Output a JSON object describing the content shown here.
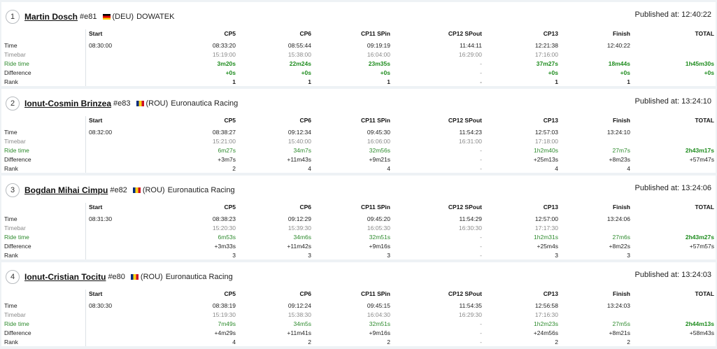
{
  "row_labels": {
    "time": "Time",
    "timebar": "Timebar",
    "ride_time": "Ride time",
    "difference": "Difference",
    "rank": "Rank"
  },
  "columns": [
    "Start",
    "CP5",
    "CP6",
    "CP11 SPin",
    "CP12 SPout",
    "CP13",
    "Finish",
    "TOTAL"
  ],
  "colors": {
    "ride_time": "#2e8b2e",
    "timebar": "#8a8a8a",
    "label_ride_time": "#2e8b2e"
  },
  "riders": [
    {
      "position": "1",
      "name": "Martin Dosch",
      "bib": "#e81",
      "flag": "flag-deu",
      "country": "(DEU)",
      "team": "DOWATEK",
      "published": "Published at: 12:40:22",
      "time": [
        "08:30:00",
        "08:33:20",
        "08:55:44",
        "09:19:19",
        "11:44:11",
        "12:21:38",
        "12:40:22",
        ""
      ],
      "timebar": [
        "",
        "15:19:00",
        "15:38:00",
        "16:04:00",
        "16:29:00",
        "17:16:00",
        "",
        ""
      ],
      "ride_time": [
        "",
        "3m20s",
        "22m24s",
        "23m35s",
        "-",
        "37m27s",
        "18m44s",
        "1h45m30s"
      ],
      "difference": [
        "",
        "+0s",
        "+0s",
        "+0s",
        "-",
        "+0s",
        "+0s",
        "+0s"
      ],
      "rank": [
        "",
        "1",
        "1",
        "1",
        "-",
        "1",
        "1",
        ""
      ]
    },
    {
      "position": "2",
      "name": "Ionut-Cosmin Brinzea",
      "bib": "#e83",
      "flag": "flag-rou",
      "country": "(ROU)",
      "team": "Euronautica Racing",
      "published": "Published at: 13:24:10",
      "time": [
        "08:32:00",
        "08:38:27",
        "09:12:34",
        "09:45:30",
        "11:54:23",
        "12:57:03",
        "13:24:10",
        ""
      ],
      "timebar": [
        "",
        "15:21:00",
        "15:40:00",
        "16:06:00",
        "16:31:00",
        "17:18:00",
        "",
        ""
      ],
      "ride_time": [
        "",
        "6m27s",
        "34m7s",
        "32m56s",
        "-",
        "1h2m40s",
        "27m7s",
        "2h43m17s"
      ],
      "difference": [
        "",
        "+3m7s",
        "+11m43s",
        "+9m21s",
        "-",
        "+25m13s",
        "+8m23s",
        "+57m47s"
      ],
      "rank": [
        "",
        "2",
        "4",
        "4",
        "-",
        "4",
        "4",
        ""
      ]
    },
    {
      "position": "3",
      "name": "Bogdan Mihai Cimpu",
      "bib": "#e82",
      "flag": "flag-rou",
      "country": "(ROU)",
      "team": "Euronautica Racing",
      "published": "Published at: 13:24:06",
      "time": [
        "08:31:30",
        "08:38:23",
        "09:12:29",
        "09:45:20",
        "11:54:29",
        "12:57:00",
        "13:24:06",
        ""
      ],
      "timebar": [
        "",
        "15:20:30",
        "15:39:30",
        "16:05:30",
        "16:30:30",
        "17:17:30",
        "",
        ""
      ],
      "ride_time": [
        "",
        "6m53s",
        "34m6s",
        "32m51s",
        "-",
        "1h2m31s",
        "27m6s",
        "2h43m27s"
      ],
      "difference": [
        "",
        "+3m33s",
        "+11m42s",
        "+9m16s",
        "-",
        "+25m4s",
        "+8m22s",
        "+57m57s"
      ],
      "rank": [
        "",
        "3",
        "3",
        "3",
        "-",
        "3",
        "3",
        ""
      ]
    },
    {
      "position": "4",
      "name": "Ionut-Cristian Tocitu",
      "bib": "#e80",
      "flag": "flag-rou",
      "country": "(ROU)",
      "team": "Euronautica Racing",
      "published": "Published at: 13:24:03",
      "time": [
        "08:30:30",
        "08:38:19",
        "09:12:24",
        "09:45:15",
        "11:54:35",
        "12:56:58",
        "13:24:03",
        ""
      ],
      "timebar": [
        "",
        "15:19:30",
        "15:38:30",
        "16:04:30",
        "16:29:30",
        "17:16:30",
        "",
        ""
      ],
      "ride_time": [
        "",
        "7m49s",
        "34m5s",
        "32m51s",
        "-",
        "1h2m23s",
        "27m5s",
        "2h44m13s"
      ],
      "difference": [
        "",
        "+4m29s",
        "+11m41s",
        "+9m16s",
        "-",
        "+24m56s",
        "+8m21s",
        "+58m43s"
      ],
      "rank": [
        "",
        "4",
        "2",
        "2",
        "-",
        "2",
        "2",
        ""
      ]
    }
  ]
}
